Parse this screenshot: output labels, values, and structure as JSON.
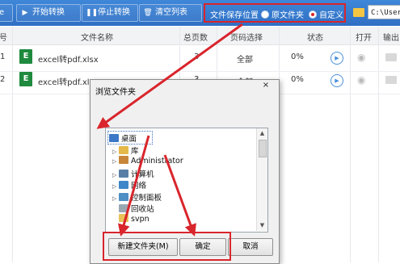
{
  "toolbar": {
    "add_label": "e",
    "start_label": "开始转换",
    "stop_label": "停止转换",
    "clear_label": "清空列表",
    "save_location_label": "文件保存位置",
    "option_original": "原文件夹",
    "option_custom": "自定义",
    "selected_option": "自定义",
    "path_value": "C:\\Users\\"
  },
  "table": {
    "headers": [
      "号",
      "文件名称",
      "总页数",
      "页码选择",
      "状态",
      "打开",
      "输出"
    ],
    "rows": [
      {
        "index": "1",
        "name": "excel转pdf.xlsx",
        "pages": "3",
        "range": "全部",
        "status": "0%"
      },
      {
        "index": "2",
        "name": "excel转pdf.xls",
        "pages": "3",
        "range": "全部",
        "status": "0%"
      }
    ]
  },
  "dialog": {
    "title": "浏览文件夹",
    "close": "×",
    "tree": [
      {
        "label": "桌面",
        "expander": "",
        "icon": "desktop-icon",
        "color": "#3b78c7"
      },
      {
        "label": "库",
        "expander": "▷",
        "icon": "library-icon",
        "color": "#e5b84a"
      },
      {
        "label": "Administrator",
        "expander": "▷",
        "icon": "user-icon",
        "color": "#c9863a"
      },
      {
        "label": "计算机",
        "expander": "▷",
        "icon": "computer-icon",
        "color": "#5a7fa6"
      },
      {
        "label": "网络",
        "expander": "▷",
        "icon": "network-icon",
        "color": "#3f87c8"
      },
      {
        "label": "控制面板",
        "expander": "▷",
        "icon": "control-panel-icon",
        "color": "#4e8fc4"
      },
      {
        "label": "回收站",
        "expander": "",
        "icon": "recycle-bin-icon",
        "color": "#9aa7b3"
      },
      {
        "label": "svpn",
        "expander": "",
        "icon": "folder-icon",
        "color": "#e8c258"
      }
    ],
    "buttons": {
      "new_folder": "新建文件夹(M)",
      "ok": "确定",
      "cancel": "取消"
    }
  },
  "colors": {
    "toolbar_blue": "#3a7fd2",
    "highlight_red": "#d9252c",
    "excel_green": "#1f8a3e"
  }
}
